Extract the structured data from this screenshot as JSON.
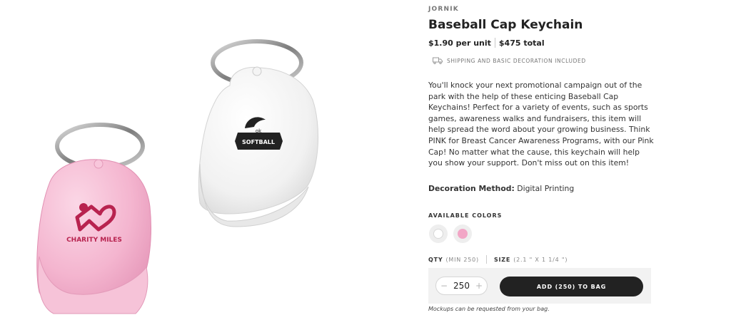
{
  "product": {
    "brand": "JORNIK",
    "title": "Baseball Cap Keychain",
    "unit_price": "$1.90 per unit",
    "total_price": "$475 total",
    "shipping_note": "SHIPPING AND BASIC DECORATION INCLUDED",
    "description": "You'll knock your next promotional campaign out of the park with the help of these enticing Baseball Cap Keychains! Perfect for a variety of events, such as sports games, awareness walks and fundraisers, this item will help spread the word about your growing business. Think PINK for Breast Cancer Awareness Programs, with our Pink Cap! No matter what the cause, this keychain will help you show your support. Don't miss out on this item!",
    "decoration_label": "Decoration Method:",
    "decoration_value": "Digital Printing"
  },
  "colors": {
    "label": "AVAILABLE COLORS",
    "options": [
      {
        "name": "white",
        "hex": "#ffffff"
      },
      {
        "name": "pink",
        "hex": "#f2a6c6"
      }
    ]
  },
  "quantity": {
    "label": "QTY",
    "min_note": "(MIN 250)",
    "size_label": "SIZE",
    "size_value": "(2.1 \" X 1 1/4 \")",
    "value": "250",
    "minus": "−",
    "plus": "+"
  },
  "cart": {
    "add_button": "ADD (250) TO BAG",
    "mockup_note": "Mockups can be requested from your bag."
  },
  "images": {
    "pink_cap_print": "CHARITY MILES",
    "white_cap_print": "SOFTBALL",
    "white_cap_small": "ok"
  },
  "theme": {
    "pink_cap": "#f4b5cf",
    "logo_red": "#b8234f",
    "button_dark": "#222222"
  }
}
